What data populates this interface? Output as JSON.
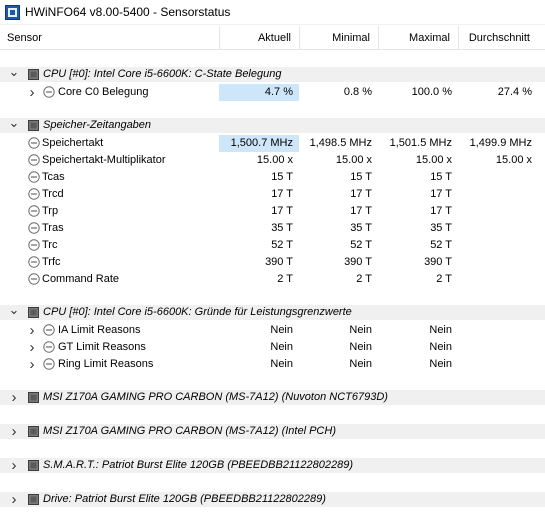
{
  "window": {
    "title": "HWiNFO64 v8.00-5400 - Sensorstatus"
  },
  "columns": [
    "Sensor",
    "Aktuell",
    "Minimal",
    "Maximal",
    "Durchschnitt"
  ],
  "groups": [
    {
      "label": "CPU [#0]: Intel Core i5-6600K: C-State Belegung",
      "expanded": true,
      "rows": [
        {
          "label": "Core C0 Belegung",
          "expandable": true,
          "values": [
            "4.7 %",
            "0.8 %",
            "100.0 %",
            "27.4 %"
          ]
        }
      ]
    },
    {
      "label": "Speicher-Zeitangaben",
      "expanded": true,
      "rows": [
        {
          "label": "Speichertakt",
          "expandable": false,
          "values": [
            "1,500.7 MHz",
            "1,498.5 MHz",
            "1,501.5 MHz",
            "1,499.9 MHz"
          ]
        },
        {
          "label": "Speichertakt-Multiplikator",
          "expandable": false,
          "values": [
            "15.00 x",
            "15.00 x",
            "15.00 x",
            "15.00 x"
          ]
        },
        {
          "label": "Tcas",
          "expandable": false,
          "values": [
            "15 T",
            "15 T",
            "15 T",
            ""
          ]
        },
        {
          "label": "Trcd",
          "expandable": false,
          "values": [
            "17 T",
            "17 T",
            "17 T",
            ""
          ]
        },
        {
          "label": "Trp",
          "expandable": false,
          "values": [
            "17 T",
            "17 T",
            "17 T",
            ""
          ]
        },
        {
          "label": "Tras",
          "expandable": false,
          "values": [
            "35 T",
            "35 T",
            "35 T",
            ""
          ]
        },
        {
          "label": "Trc",
          "expandable": false,
          "values": [
            "52 T",
            "52 T",
            "52 T",
            ""
          ]
        },
        {
          "label": "Trfc",
          "expandable": false,
          "values": [
            "390 T",
            "390 T",
            "390 T",
            ""
          ]
        },
        {
          "label": "Command Rate",
          "expandable": false,
          "values": [
            "2 T",
            "2 T",
            "2 T",
            ""
          ]
        }
      ]
    },
    {
      "label": "CPU [#0]: Intel Core i5-6600K: Gründe für Leistungsgrenzwerte",
      "expanded": true,
      "rows": [
        {
          "label": "IA Limit Reasons",
          "expandable": true,
          "values": [
            "Nein",
            "Nein",
            "Nein",
            ""
          ]
        },
        {
          "label": "GT Limit Reasons",
          "expandable": true,
          "values": [
            "Nein",
            "Nein",
            "Nein",
            ""
          ]
        },
        {
          "label": "Ring Limit Reasons",
          "expandable": true,
          "values": [
            "Nein",
            "Nein",
            "Nein",
            ""
          ]
        }
      ]
    },
    {
      "label": "MSI Z170A GAMING PRO CARBON (MS-7A12) (Nuvoton NCT6793D)",
      "expanded": false,
      "rows": []
    },
    {
      "label": "MSI Z170A GAMING PRO CARBON (MS-7A12) (Intel PCH)",
      "expanded": false,
      "rows": []
    },
    {
      "label": "S.M.A.R.T.: Patriot Burst Elite 120GB (PBEEDBB21122802289)",
      "expanded": false,
      "rows": []
    },
    {
      "label": "Drive: Patriot Burst Elite 120GB (PBEEDBB21122802289)",
      "expanded": false,
      "rows": []
    }
  ],
  "icons": {
    "app": "hwinfo-app-icon",
    "group": "sensor-group-icon",
    "row": "gauge-icon",
    "expand": "chevron-right-icon",
    "collapse": "chevron-down-icon"
  },
  "colors": {
    "highlight": "#cde6fa",
    "group_background": "#f0f0f0"
  }
}
